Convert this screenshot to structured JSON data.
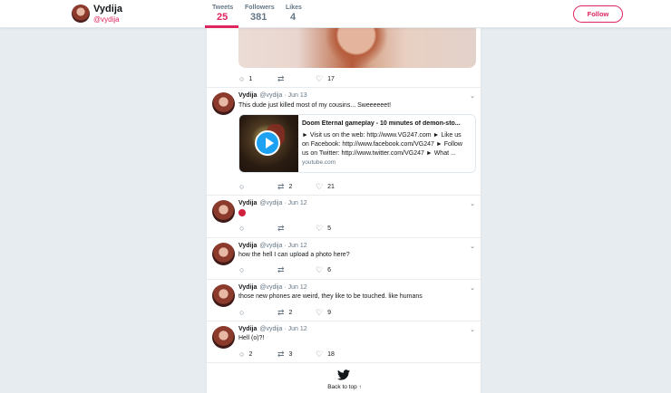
{
  "profile": {
    "name": "Vydija",
    "handle": "@vydija"
  },
  "stats": [
    {
      "label": "Tweets",
      "value": "25"
    },
    {
      "label": "Followers",
      "value": "381"
    },
    {
      "label": "Likes",
      "value": "4"
    }
  ],
  "follow_label": "Follow",
  "top_tweet_actions": {
    "retweets": "1",
    "likes": "17"
  },
  "tweets": [
    {
      "name": "Vydija",
      "meta": "@vydija · Jun 13",
      "text": "This dude just killed most of my cousins...  Sweeeeeet!",
      "replies": "",
      "retweets": "2",
      "likes": "21",
      "card": {
        "title": "Doom Eternal gameplay - 10 minutes of demon-sto...",
        "desc_lines": [
          "► Visit us on the web: http://www.VG247.com ► Like us",
          "on Facebook: http://www.facebook.com/VG247 ► Follow",
          "us on Twitter: http://www.twitter.com/VG247 ► What ..."
        ],
        "domain": "youtube.com"
      }
    },
    {
      "name": "Vydija",
      "meta": "@vydija · Jun 12",
      "text": "",
      "replies": "",
      "retweets": "",
      "likes": "5"
    },
    {
      "name": "Vydija",
      "meta": "@vydija · Jun 12",
      "text": "how the hell I can upload a photo here?",
      "replies": "",
      "retweets": "",
      "likes": "6"
    },
    {
      "name": "Vydija",
      "meta": "@vydija · Jun 12",
      "text": "those new phones are weird, they like to be touched. like humans",
      "replies": "",
      "retweets": "2",
      "likes": "9"
    },
    {
      "name": "Vydija",
      "meta": "@vydija · Jun 12",
      "text": "Hell (o)?!",
      "replies": "2",
      "retweets": "3",
      "likes": "18"
    }
  ],
  "back_to_top": "Back to top ↑",
  "colors": {
    "accent": "#e0245e",
    "link": "#1da1f2"
  }
}
